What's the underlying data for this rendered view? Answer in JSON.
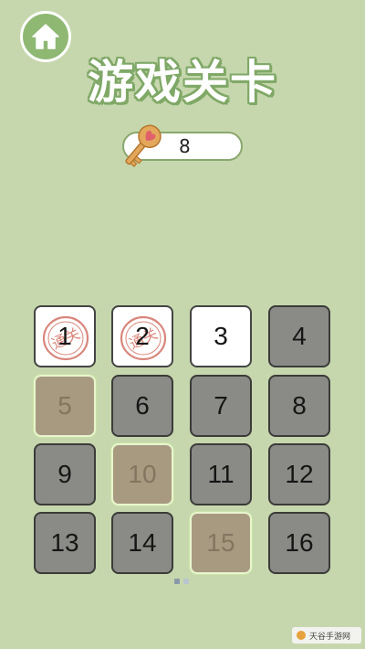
{
  "header": {
    "title": "游戏关卡"
  },
  "keys": {
    "count": "8",
    "icon": "key-icon"
  },
  "levels": [
    {
      "label": "1",
      "state": "cleared",
      "stamp": "通关"
    },
    {
      "label": "2",
      "state": "cleared",
      "stamp": "通关"
    },
    {
      "label": "3",
      "state": "current"
    },
    {
      "label": "4",
      "state": "locked"
    },
    {
      "label": "5",
      "state": "keylock"
    },
    {
      "label": "6",
      "state": "locked"
    },
    {
      "label": "7",
      "state": "locked"
    },
    {
      "label": "8",
      "state": "locked"
    },
    {
      "label": "9",
      "state": "locked"
    },
    {
      "label": "10",
      "state": "keylock"
    },
    {
      "label": "11",
      "state": "locked"
    },
    {
      "label": "12",
      "state": "locked"
    },
    {
      "label": "13",
      "state": "locked"
    },
    {
      "label": "14",
      "state": "locked"
    },
    {
      "label": "15",
      "state": "keylock"
    },
    {
      "label": "16",
      "state": "locked"
    }
  ],
  "pagination": {
    "pages": 2,
    "active": 1
  },
  "watermark": {
    "text": "天谷手游网"
  },
  "colors": {
    "background": "#c6d7ad",
    "accent": "#8fb873",
    "locked": "#8a8a86",
    "keylock": "#a89a80",
    "stamp": "#d9867c"
  }
}
